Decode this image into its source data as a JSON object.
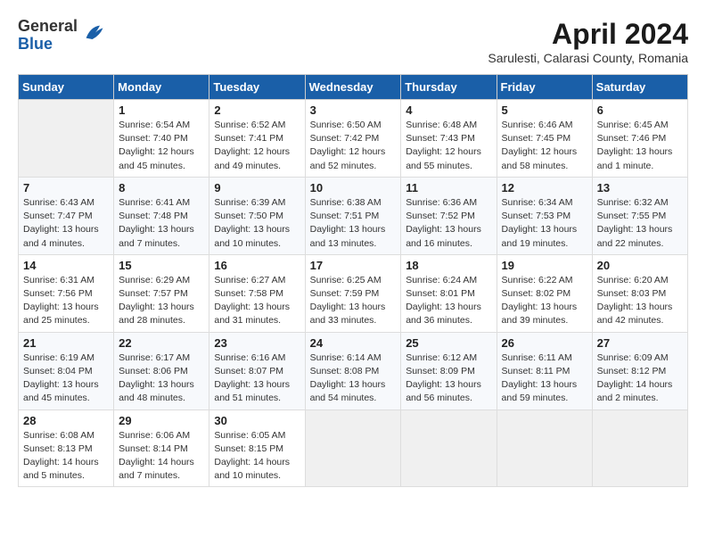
{
  "header": {
    "logo_general": "General",
    "logo_blue": "Blue",
    "title": "April 2024",
    "subtitle": "Sarulesti, Calarasi County, Romania"
  },
  "weekdays": [
    "Sunday",
    "Monday",
    "Tuesday",
    "Wednesday",
    "Thursday",
    "Friday",
    "Saturday"
  ],
  "weeks": [
    [
      {
        "day": "",
        "sunrise": "",
        "sunset": "",
        "daylight": ""
      },
      {
        "day": "1",
        "sunrise": "Sunrise: 6:54 AM",
        "sunset": "Sunset: 7:40 PM",
        "daylight": "Daylight: 12 hours and 45 minutes."
      },
      {
        "day": "2",
        "sunrise": "Sunrise: 6:52 AM",
        "sunset": "Sunset: 7:41 PM",
        "daylight": "Daylight: 12 hours and 49 minutes."
      },
      {
        "day": "3",
        "sunrise": "Sunrise: 6:50 AM",
        "sunset": "Sunset: 7:42 PM",
        "daylight": "Daylight: 12 hours and 52 minutes."
      },
      {
        "day": "4",
        "sunrise": "Sunrise: 6:48 AM",
        "sunset": "Sunset: 7:43 PM",
        "daylight": "Daylight: 12 hours and 55 minutes."
      },
      {
        "day": "5",
        "sunrise": "Sunrise: 6:46 AM",
        "sunset": "Sunset: 7:45 PM",
        "daylight": "Daylight: 12 hours and 58 minutes."
      },
      {
        "day": "6",
        "sunrise": "Sunrise: 6:45 AM",
        "sunset": "Sunset: 7:46 PM",
        "daylight": "Daylight: 13 hours and 1 minute."
      }
    ],
    [
      {
        "day": "7",
        "sunrise": "Sunrise: 6:43 AM",
        "sunset": "Sunset: 7:47 PM",
        "daylight": "Daylight: 13 hours and 4 minutes."
      },
      {
        "day": "8",
        "sunrise": "Sunrise: 6:41 AM",
        "sunset": "Sunset: 7:48 PM",
        "daylight": "Daylight: 13 hours and 7 minutes."
      },
      {
        "day": "9",
        "sunrise": "Sunrise: 6:39 AM",
        "sunset": "Sunset: 7:50 PM",
        "daylight": "Daylight: 13 hours and 10 minutes."
      },
      {
        "day": "10",
        "sunrise": "Sunrise: 6:38 AM",
        "sunset": "Sunset: 7:51 PM",
        "daylight": "Daylight: 13 hours and 13 minutes."
      },
      {
        "day": "11",
        "sunrise": "Sunrise: 6:36 AM",
        "sunset": "Sunset: 7:52 PM",
        "daylight": "Daylight: 13 hours and 16 minutes."
      },
      {
        "day": "12",
        "sunrise": "Sunrise: 6:34 AM",
        "sunset": "Sunset: 7:53 PM",
        "daylight": "Daylight: 13 hours and 19 minutes."
      },
      {
        "day": "13",
        "sunrise": "Sunrise: 6:32 AM",
        "sunset": "Sunset: 7:55 PM",
        "daylight": "Daylight: 13 hours and 22 minutes."
      }
    ],
    [
      {
        "day": "14",
        "sunrise": "Sunrise: 6:31 AM",
        "sunset": "Sunset: 7:56 PM",
        "daylight": "Daylight: 13 hours and 25 minutes."
      },
      {
        "day": "15",
        "sunrise": "Sunrise: 6:29 AM",
        "sunset": "Sunset: 7:57 PM",
        "daylight": "Daylight: 13 hours and 28 minutes."
      },
      {
        "day": "16",
        "sunrise": "Sunrise: 6:27 AM",
        "sunset": "Sunset: 7:58 PM",
        "daylight": "Daylight: 13 hours and 31 minutes."
      },
      {
        "day": "17",
        "sunrise": "Sunrise: 6:25 AM",
        "sunset": "Sunset: 7:59 PM",
        "daylight": "Daylight: 13 hours and 33 minutes."
      },
      {
        "day": "18",
        "sunrise": "Sunrise: 6:24 AM",
        "sunset": "Sunset: 8:01 PM",
        "daylight": "Daylight: 13 hours and 36 minutes."
      },
      {
        "day": "19",
        "sunrise": "Sunrise: 6:22 AM",
        "sunset": "Sunset: 8:02 PM",
        "daylight": "Daylight: 13 hours and 39 minutes."
      },
      {
        "day": "20",
        "sunrise": "Sunrise: 6:20 AM",
        "sunset": "Sunset: 8:03 PM",
        "daylight": "Daylight: 13 hours and 42 minutes."
      }
    ],
    [
      {
        "day": "21",
        "sunrise": "Sunrise: 6:19 AM",
        "sunset": "Sunset: 8:04 PM",
        "daylight": "Daylight: 13 hours and 45 minutes."
      },
      {
        "day": "22",
        "sunrise": "Sunrise: 6:17 AM",
        "sunset": "Sunset: 8:06 PM",
        "daylight": "Daylight: 13 hours and 48 minutes."
      },
      {
        "day": "23",
        "sunrise": "Sunrise: 6:16 AM",
        "sunset": "Sunset: 8:07 PM",
        "daylight": "Daylight: 13 hours and 51 minutes."
      },
      {
        "day": "24",
        "sunrise": "Sunrise: 6:14 AM",
        "sunset": "Sunset: 8:08 PM",
        "daylight": "Daylight: 13 hours and 54 minutes."
      },
      {
        "day": "25",
        "sunrise": "Sunrise: 6:12 AM",
        "sunset": "Sunset: 8:09 PM",
        "daylight": "Daylight: 13 hours and 56 minutes."
      },
      {
        "day": "26",
        "sunrise": "Sunrise: 6:11 AM",
        "sunset": "Sunset: 8:11 PM",
        "daylight": "Daylight: 13 hours and 59 minutes."
      },
      {
        "day": "27",
        "sunrise": "Sunrise: 6:09 AM",
        "sunset": "Sunset: 8:12 PM",
        "daylight": "Daylight: 14 hours and 2 minutes."
      }
    ],
    [
      {
        "day": "28",
        "sunrise": "Sunrise: 6:08 AM",
        "sunset": "Sunset: 8:13 PM",
        "daylight": "Daylight: 14 hours and 5 minutes."
      },
      {
        "day": "29",
        "sunrise": "Sunrise: 6:06 AM",
        "sunset": "Sunset: 8:14 PM",
        "daylight": "Daylight: 14 hours and 7 minutes."
      },
      {
        "day": "30",
        "sunrise": "Sunrise: 6:05 AM",
        "sunset": "Sunset: 8:15 PM",
        "daylight": "Daylight: 14 hours and 10 minutes."
      },
      {
        "day": "",
        "sunrise": "",
        "sunset": "",
        "daylight": ""
      },
      {
        "day": "",
        "sunrise": "",
        "sunset": "",
        "daylight": ""
      },
      {
        "day": "",
        "sunrise": "",
        "sunset": "",
        "daylight": ""
      },
      {
        "day": "",
        "sunrise": "",
        "sunset": "",
        "daylight": ""
      }
    ]
  ]
}
